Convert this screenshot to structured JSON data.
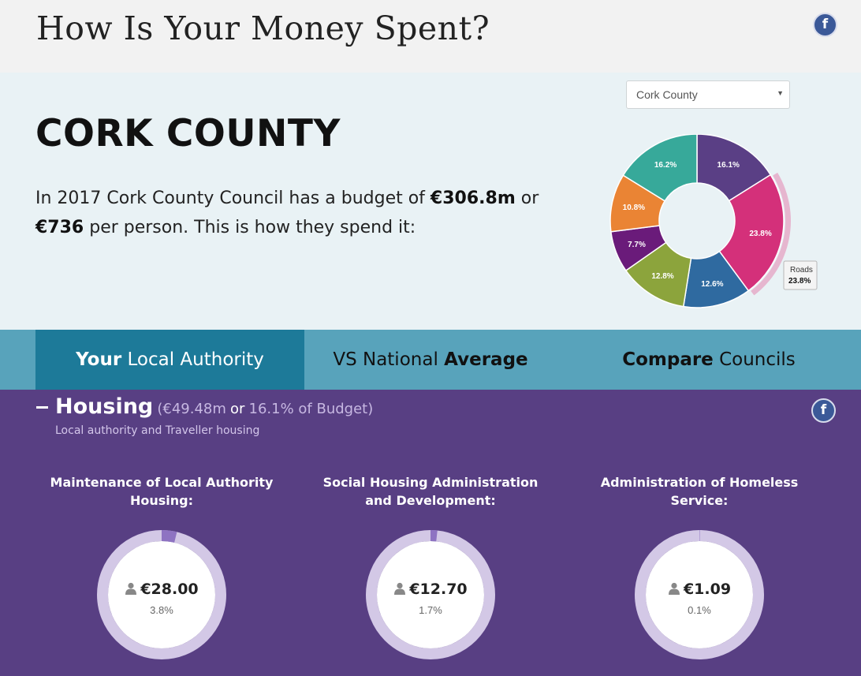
{
  "header": {
    "title": "How Is Your Money Spent?",
    "facebook_label": "f"
  },
  "council_select": {
    "selected": "Cork County"
  },
  "hero": {
    "council_name": "CORK COUNTY",
    "intro_before_budget": "In 2017 Cork County Council has a budget of ",
    "budget": "€306.8m",
    "intro_between": " or ",
    "per_person": "€736",
    "intro_after": " per person. This is how they spend it:"
  },
  "chart_data": {
    "type": "pie",
    "donut": true,
    "slices": [
      {
        "value": 16.1,
        "label": "16.1%",
        "color": "#5a3f85"
      },
      {
        "value": 23.8,
        "label": "23.8%",
        "color": "#d4307a",
        "highlighted": true
      },
      {
        "value": 12.6,
        "label": "12.6%",
        "color": "#2f6aa0"
      },
      {
        "value": 12.8,
        "label": "12.8%",
        "color": "#8ca43c"
      },
      {
        "value": 7.7,
        "label": "7.7%",
        "color": "#6a1b7a"
      },
      {
        "value": 10.8,
        "label": "10.8%",
        "color": "#ea8434"
      },
      {
        "value": 16.2,
        "label": "16.2%",
        "color": "#37a99a"
      }
    ],
    "tooltip": {
      "name": "Roads",
      "value": "23.8%"
    }
  },
  "tabs": [
    {
      "bold": "Your",
      "text": " Local Authority",
      "active": true
    },
    {
      "text": "VS National ",
      "bold": "Average",
      "active": false
    },
    {
      "bold": "Compare",
      "text": " Councils",
      "active": false
    }
  ],
  "category": {
    "title": "Housing",
    "amount": "(€49.48m",
    "or": "or",
    "share": "16.1% of Budget)",
    "subtitle": "Local authority and Traveller housing",
    "services": [
      {
        "title": "Maintenance of Local Authority Housing:",
        "amount": "€28.00",
        "percent": "3.8%",
        "fraction": 0.038
      },
      {
        "title": "Social Housing Administration and Development:",
        "amount": "€12.70",
        "percent": "1.7%",
        "fraction": 0.017
      },
      {
        "title": "Administration of Homeless Service:",
        "amount": "€1.09",
        "percent": "0.1%",
        "fraction": 0.001
      }
    ]
  },
  "colors": {
    "hero_bg": "#e9f2f5",
    "tab_bar": "#58a3bb",
    "tab_active": "#1d7a99",
    "panel": "#583f83",
    "ring_track": "#d3c8e6",
    "ring_fill": "#8e73c2"
  }
}
